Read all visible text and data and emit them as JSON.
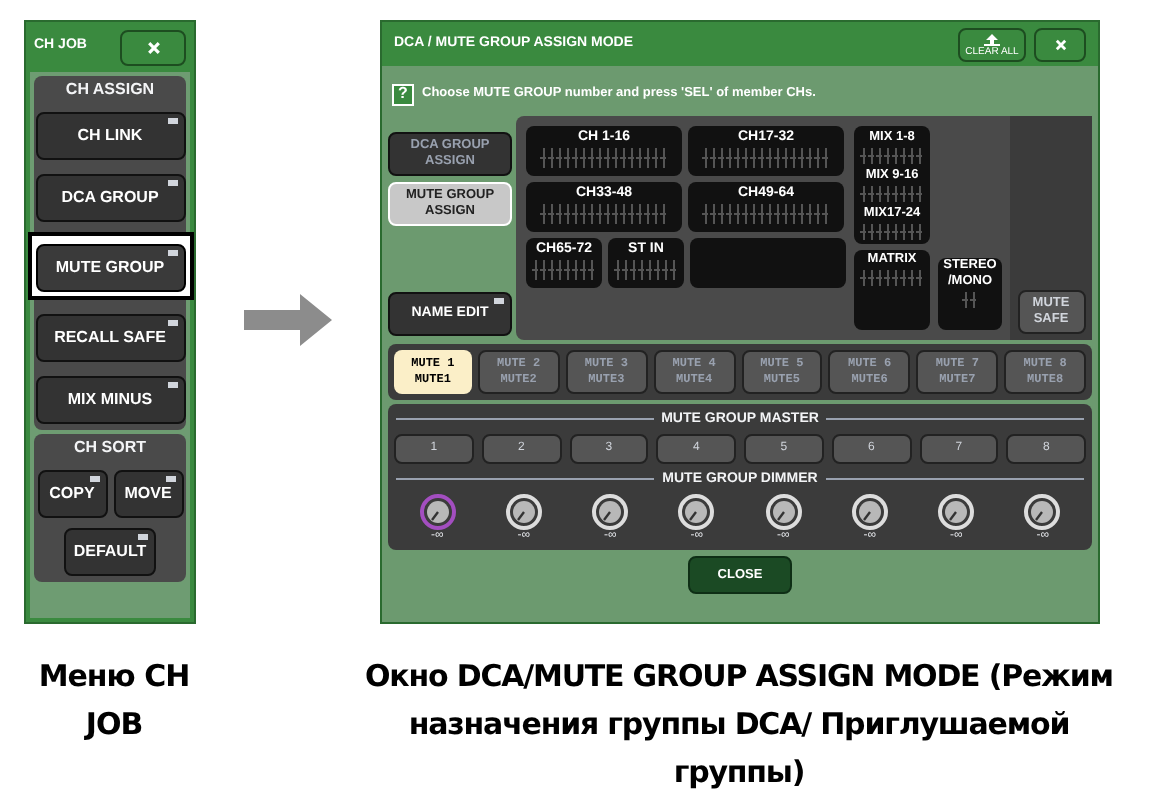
{
  "menu": {
    "title": "CH JOB",
    "sections": [
      {
        "title": "CH ASSIGN",
        "buttons": [
          {
            "label": "CH LINK",
            "selected": false
          },
          {
            "label": "DCA GROUP",
            "selected": false
          },
          {
            "label": "MUTE GROUP",
            "selected": true
          },
          {
            "label": "RECALL SAFE",
            "selected": false
          },
          {
            "label": "MIX MINUS",
            "selected": false
          }
        ]
      },
      {
        "title": "CH SORT",
        "buttons": [
          {
            "label": "COPY",
            "selected": false
          },
          {
            "label": "MOVE",
            "selected": false
          },
          {
            "label": "DEFAULT",
            "selected": false
          }
        ]
      }
    ]
  },
  "window": {
    "title": "DCA / MUTE GROUP ASSIGN MODE",
    "clear_all": "CLEAR ALL",
    "help_mark": "?",
    "help": "Choose MUTE GROUP number and press 'SEL' of member CHs.",
    "mode_tabs": [
      {
        "label": "DCA GROUP ASSIGN",
        "selected": false
      },
      {
        "label": "MUTE GROUP ASSIGN",
        "selected": true
      }
    ],
    "channel_blocks": [
      [
        "CH 1-16",
        "CH17-32"
      ],
      [
        "CH33-48",
        "CH49-64"
      ],
      [
        "CH65-72",
        "ST IN"
      ]
    ],
    "mix_blocks": [
      "MIX 1-8",
      "MIX 9-16",
      "MIX17-24"
    ],
    "matrix": "MATRIX",
    "stereo": "STEREO /MONO",
    "name_edit": "NAME EDIT",
    "mute_safe": "MUTE SAFE",
    "groups": [
      {
        "label": "MUTE 1",
        "name": "MUTE1",
        "selected": true
      },
      {
        "label": "MUTE 2",
        "name": "MUTE2",
        "selected": false
      },
      {
        "label": "MUTE 3",
        "name": "MUTE3",
        "selected": false
      },
      {
        "label": "MUTE 4",
        "name": "MUTE4",
        "selected": false
      },
      {
        "label": "MUTE 5",
        "name": "MUTE5",
        "selected": false
      },
      {
        "label": "MUTE 6",
        "name": "MUTE6",
        "selected": false
      },
      {
        "label": "MUTE 7",
        "name": "MUTE7",
        "selected": false
      },
      {
        "label": "MUTE 8",
        "name": "MUTE8",
        "selected": false
      }
    ],
    "master_title": "MUTE GROUP MASTER",
    "masters": [
      "1",
      "2",
      "3",
      "4",
      "5",
      "6",
      "7",
      "8"
    ],
    "dimmer_title": "MUTE GROUP DIMMER",
    "dimmers": [
      {
        "reading": "-∞",
        "selected": true
      },
      {
        "reading": "-∞",
        "selected": false
      },
      {
        "reading": "-∞",
        "selected": false
      },
      {
        "reading": "-∞",
        "selected": false
      },
      {
        "reading": "-∞",
        "selected": false
      },
      {
        "reading": "-∞",
        "selected": false
      },
      {
        "reading": "-∞",
        "selected": false
      },
      {
        "reading": "-∞",
        "selected": false
      }
    ],
    "close": "CLOSE"
  },
  "captions": {
    "menu": "Меню CH JOB",
    "window": "Окно DCA/MUTE GROUP ASSIGN MODE (Режим назначения группы DCA/ Приглушаемой группы)"
  }
}
